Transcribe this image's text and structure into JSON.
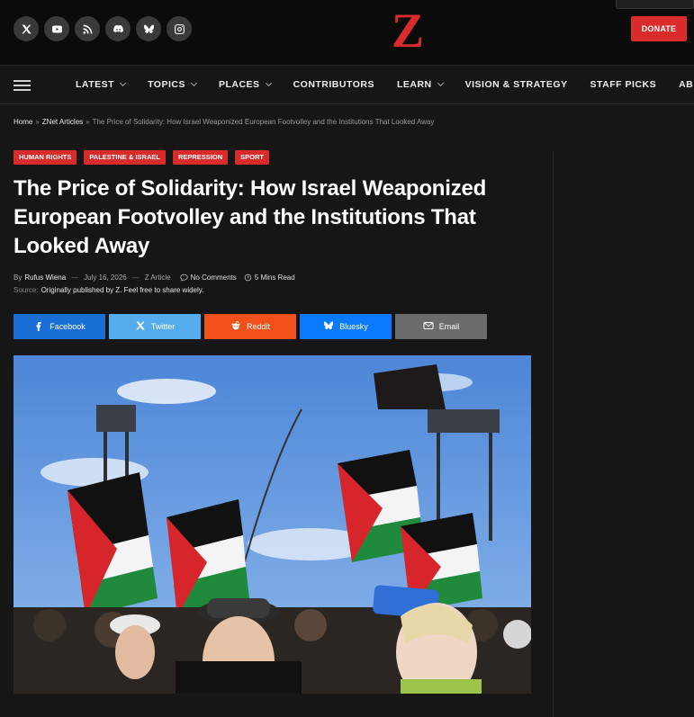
{
  "header": {
    "social_icons": [
      "x-icon",
      "youtube-icon",
      "rss-icon",
      "discord-icon",
      "bluesky-icon",
      "instagram-icon"
    ],
    "logo_text": "Z",
    "donate_label": "DONATE",
    "brand_color": "#d92b2b"
  },
  "nav": {
    "items": [
      {
        "label": "LATEST",
        "dropdown": true
      },
      {
        "label": "TOPICS",
        "dropdown": true
      },
      {
        "label": "PLACES",
        "dropdown": true
      },
      {
        "label": "CONTRIBUTORS",
        "dropdown": false
      },
      {
        "label": "LEARN",
        "dropdown": true
      },
      {
        "label": "VISION & STRATEGY",
        "dropdown": false
      },
      {
        "label": "STAFF PICKS",
        "dropdown": false
      },
      {
        "label": "AB",
        "dropdown": false
      }
    ]
  },
  "breadcrumb": {
    "home": "Home",
    "sep": "»",
    "section": "ZNet Articles",
    "current": "The Price of Solidarity: How Israel Weaponized European Footvolley and the Institutions That Looked Away"
  },
  "article": {
    "categories": [
      "HUMAN RIGHTS",
      "PALESTINE & ISRAEL",
      "REPRESSION",
      "SPORT"
    ],
    "title": "The Price of Solidarity: How Israel Weaponized European Footvolley and the Institutions That Looked Away",
    "by_label": "By",
    "author": "Rufus Wiena",
    "dash": "—",
    "date": "July 16, 2026",
    "type": "Z Article",
    "comments": "No Comments",
    "read_time": "5 Mins Read",
    "source_label": "Source:",
    "source_value": "Originally published by Z. Feel free to share widely."
  },
  "share": [
    {
      "label": "Facebook",
      "icon": "facebook-icon",
      "color": "#1a6fd6"
    },
    {
      "label": "Twitter",
      "icon": "x-icon",
      "color": "#55acee"
    },
    {
      "label": "Reddit",
      "icon": "reddit-icon",
      "color": "#f2501b"
    },
    {
      "label": "Bluesky",
      "icon": "bluesky-icon",
      "color": "#0a7aff"
    },
    {
      "label": "Email",
      "icon": "email-icon",
      "color": "#6b6b6b"
    }
  ]
}
